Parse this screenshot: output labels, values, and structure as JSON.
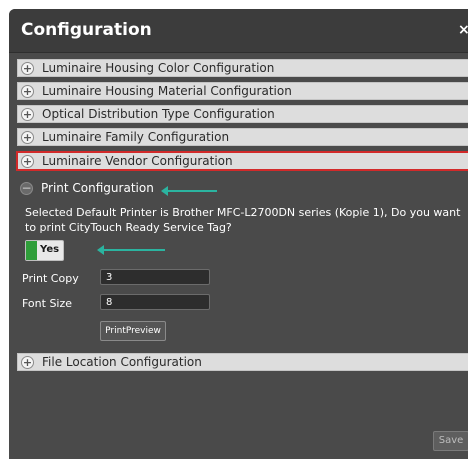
{
  "dialog": {
    "title": "Configuration",
    "close_glyph": "×"
  },
  "sections": [
    {
      "label": "Luminaire Housing Color Configuration",
      "state": "collapsed"
    },
    {
      "label": "Luminaire Housing Material Configuration",
      "state": "collapsed"
    },
    {
      "label": "Optical Distribution Type Configuration",
      "state": "collapsed"
    },
    {
      "label": "Luminaire Family Configuration",
      "state": "collapsed"
    },
    {
      "label": "Luminaire Vendor Configuration",
      "state": "collapsed-selected"
    },
    {
      "label": "Print Configuration",
      "state": "expanded"
    },
    {
      "label": "File Location Configuration",
      "state": "collapsed"
    }
  ],
  "print_config": {
    "message": "Selected Default Printer is Brother MFC-L2700DN series (Kopie 1), Do you want to print CityTouch Ready Service Tag?",
    "toggle_label": "Yes",
    "print_copy_label": "Print Copy",
    "print_copy_value": "3",
    "font_size_label": "Font Size",
    "font_size_value": "8",
    "preview_button": "PrintPreview"
  },
  "footer": {
    "save_label": "Save"
  },
  "colors": {
    "accent_arrow": "#2bb4a0",
    "selected_border": "#d22a2a",
    "toggle_on": "#2f9e3a"
  },
  "icons": {
    "expand": "plus-circle-icon",
    "collapse": "minus-circle-icon",
    "close": "close-icon"
  }
}
